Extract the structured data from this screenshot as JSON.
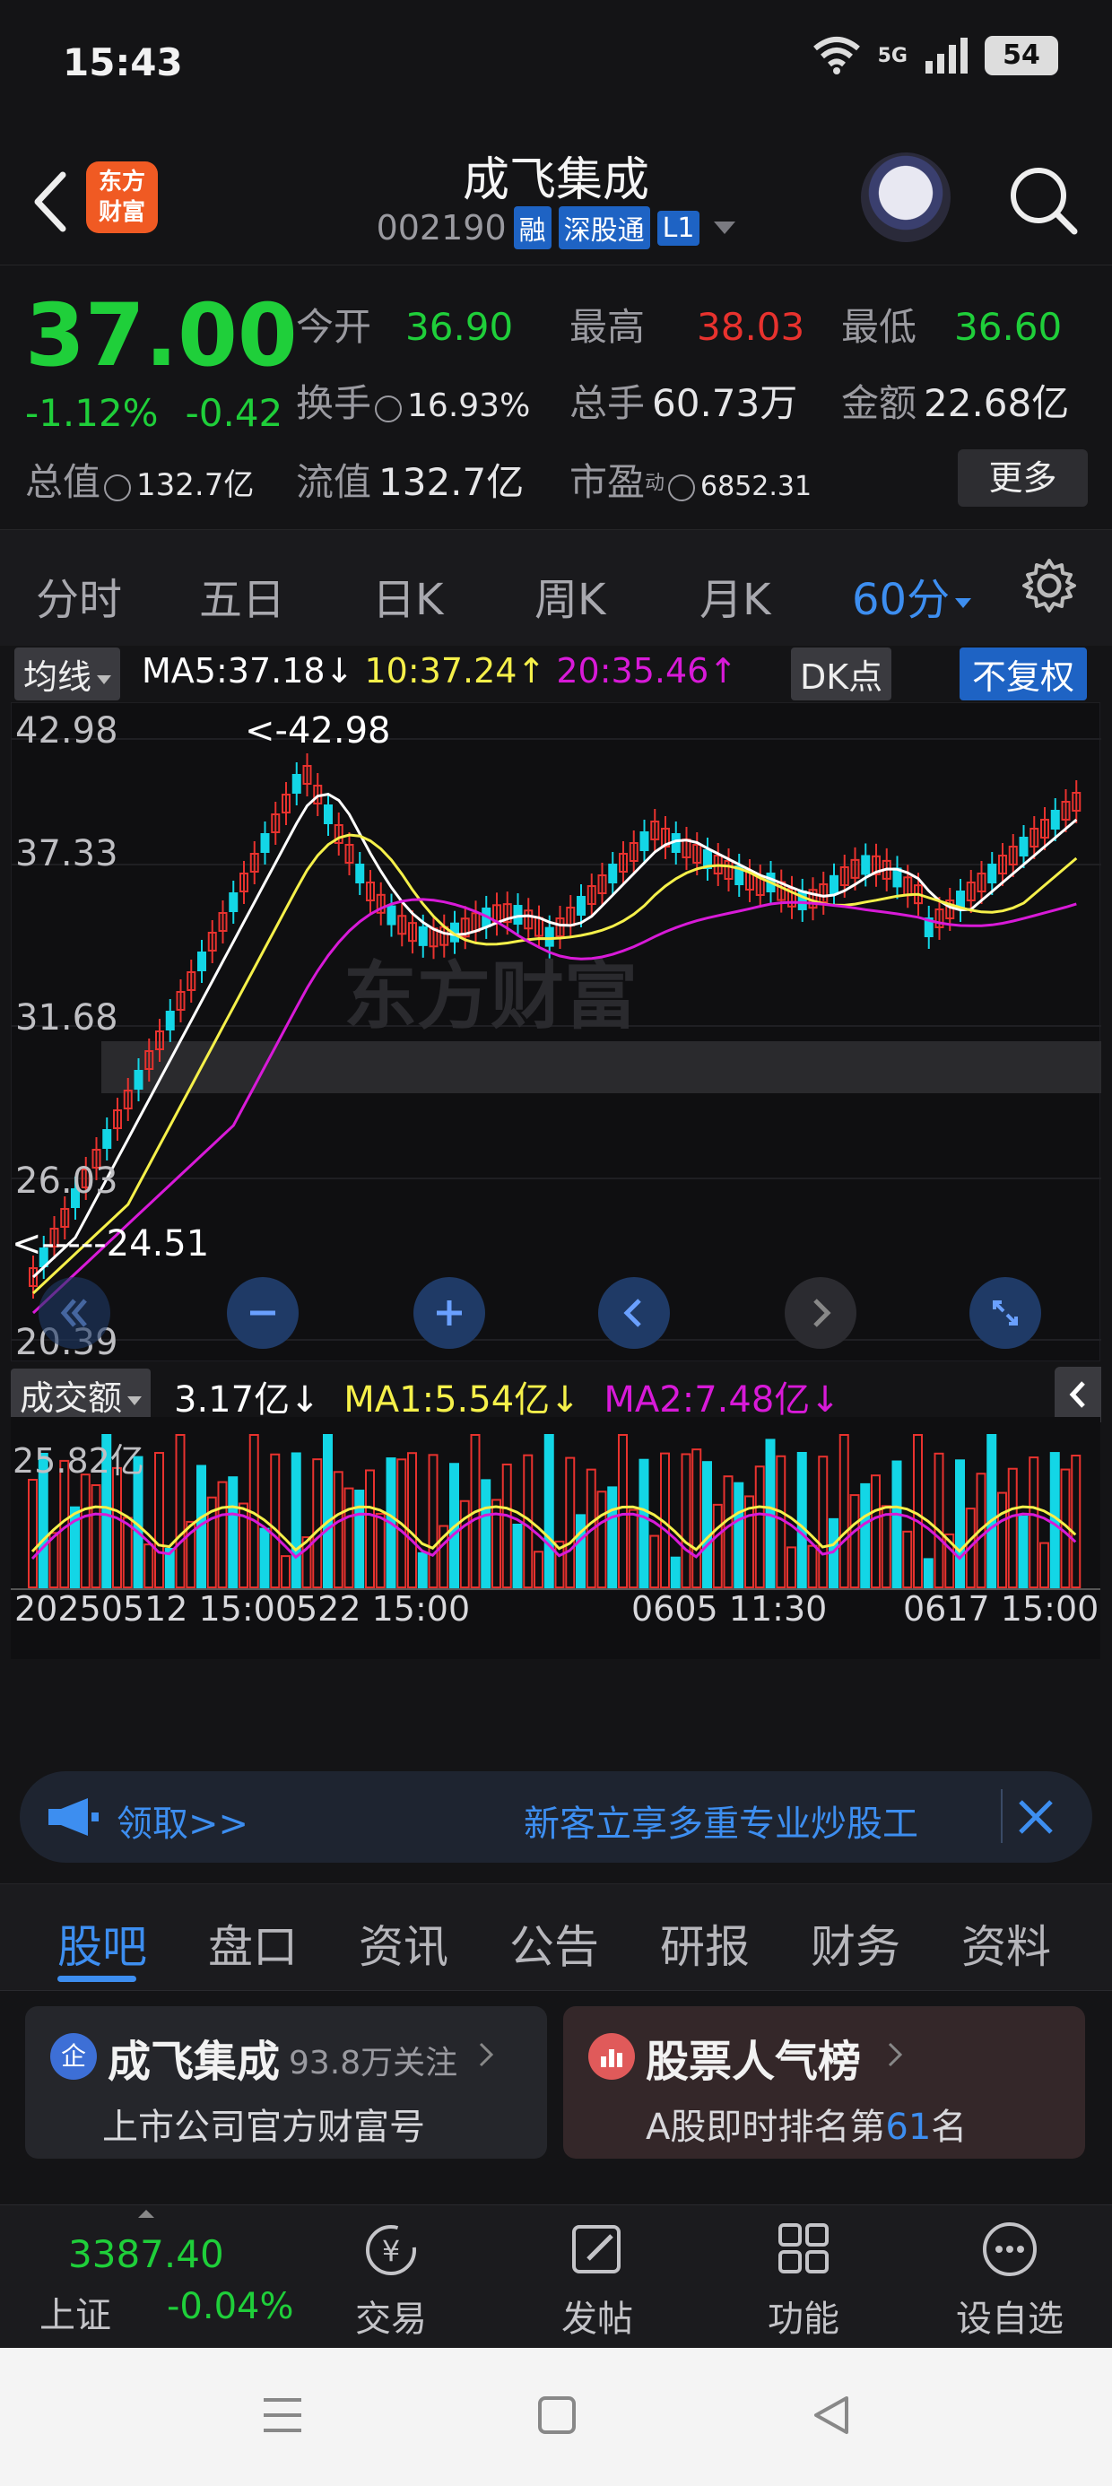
{
  "status": {
    "time": "15:43",
    "network": "5G",
    "battery": "54"
  },
  "header": {
    "title": "成飞集成",
    "code": "002190",
    "tags": [
      "融",
      "深股通",
      "L1"
    ],
    "logo_text": "东方财富"
  },
  "quote": {
    "price": "37.00",
    "change_pct": "-1.12%",
    "change": "-0.42",
    "rows": [
      [
        {
          "label": "今开",
          "value": "36.90",
          "color": "green"
        },
        {
          "label": "最高",
          "value": "38.03",
          "color": "red"
        },
        {
          "label": "最低",
          "value": "36.60",
          "color": "green"
        }
      ],
      [
        {
          "label": "换手",
          "value": "16.93%",
          "icon": true
        },
        {
          "label": "总手",
          "value": "60.73万"
        },
        {
          "label": "金额",
          "value": "22.68亿"
        }
      ],
      [
        {
          "label": "总值",
          "value": "132.7亿",
          "icon": true
        },
        {
          "label": "流值",
          "value": "132.7亿"
        },
        {
          "label": "市盈",
          "value": "6852.31",
          "sup": "动",
          "icon": true
        }
      ]
    ],
    "more": "更多"
  },
  "period_tabs": [
    "分时",
    "五日",
    "日K",
    "周K",
    "月K",
    "60分"
  ],
  "active_period": "60分",
  "ma_bar": {
    "selector": "均线",
    "ma5": "MA5:37.18",
    "ma10": "10:37.24",
    "ma20": "20:35.46",
    "dk": "DK点",
    "fq": "不复权"
  },
  "kchart": {
    "y_labels": [
      "42.98",
      "37.33",
      "31.68",
      "26.03",
      "20.39"
    ],
    "high_note": "<-42.98",
    "low_note": "<-----24.51",
    "watermark": "东方财富"
  },
  "vol_bar": {
    "selector": "成交额",
    "val": "3.17亿",
    "ma1": "MA1:5.54亿",
    "ma2": "MA2:7.48亿",
    "y_max": "25.82亿"
  },
  "x_labels": [
    "20250512 15:00",
    "522 15:00",
    "0605 11:30",
    "0617 15:00"
  ],
  "colors": {
    "up": "#e8322e",
    "down": "#13d6e6",
    "ma5": "#ffffff",
    "ma10": "#f5f04a",
    "ma20": "#d81ad8",
    "accent": "#3d8ef0",
    "green": "#1fcf3a"
  },
  "banner": {
    "left": "领取>>",
    "right": "新客立享多重专业炒股工"
  },
  "section_tabs": [
    "股吧",
    "盘口",
    "资讯",
    "公告",
    "研报",
    "财务",
    "资料"
  ],
  "cards": [
    {
      "title": "成飞集成",
      "meta": "93.8万关注",
      "sub": "上市公司官方财富号"
    },
    {
      "title": "股票人气榜",
      "sub_prefix": "A股即时排名第",
      "rank": "61",
      "sub_suffix": "名"
    }
  ],
  "bottom_nav": {
    "index_value": "3387.40",
    "index_name": "上证",
    "index_change": "-0.04%",
    "items": [
      "交易",
      "发帖",
      "功能",
      "设自选"
    ]
  }
}
